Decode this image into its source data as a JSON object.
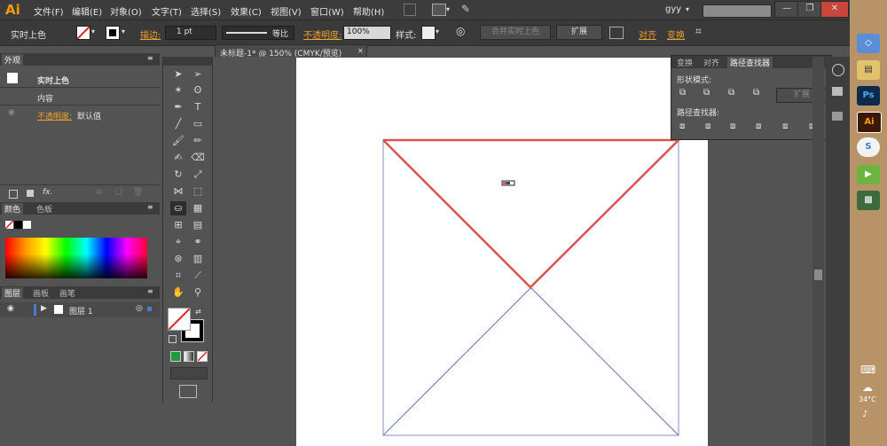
{
  "app": {
    "logo": "Ai",
    "user": "gyy"
  },
  "menu": [
    "文件(F)",
    "编辑(E)",
    "对象(O)",
    "文字(T)",
    "选择(S)",
    "效果(C)",
    "视图(V)",
    "窗口(W)",
    "帮助(H)"
  ],
  "window_buttons": {
    "minimize": "—",
    "restore": "❐",
    "close": "✕"
  },
  "control_bar": {
    "selection_label": "实时上色",
    "stroke_label": "描边:",
    "stroke_value": "1 pt",
    "profile_label": "等比",
    "opacity_label": "不透明度:",
    "opacity_value": "100%",
    "style_label": "样式:",
    "merge_button": "合并实时上色",
    "expand_button": "扩展",
    "align_label": "对齐",
    "transform_label": "变换"
  },
  "appearance_panel": {
    "tab": "外观",
    "header": "实时上色",
    "content": "内容",
    "opacity_label": "不透明度:",
    "opacity_value": "默认值",
    "fx_label": "fx."
  },
  "color_panel": {
    "tabs": [
      "颜色",
      "色板"
    ]
  },
  "layers_panel": {
    "tabs": [
      "图层",
      "画板",
      "画笔"
    ],
    "layer_name": "图层 1"
  },
  "document": {
    "tab_title": "未标题-1* @ 150% (CMYK/预览)",
    "close": "✕"
  },
  "pathfinder_panel": {
    "tabs": [
      "变换",
      "对齐",
      "路径查找器"
    ],
    "shape_modes_label": "形状模式:",
    "expand_button": "扩展",
    "pathfinders_label": "路径查找器:"
  },
  "taskbar": {
    "weather": "34°C",
    "ps_label": "Ps",
    "ai_label": "Ai"
  },
  "colors": {
    "accent_orange": "#ff9a00",
    "red_stroke": "#d9534f",
    "blue_stroke": "#5a6fb0"
  }
}
